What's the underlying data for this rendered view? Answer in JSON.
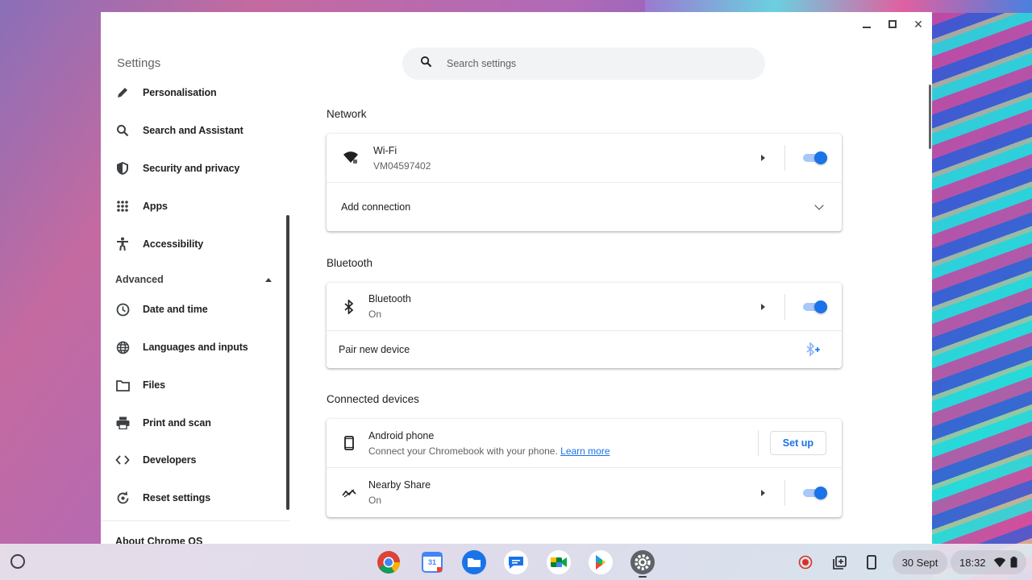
{
  "window": {
    "controls": {
      "minimize": "minimize",
      "maximize": "maximize",
      "close": "✕"
    }
  },
  "sidebar": {
    "title": "Settings",
    "items": [
      {
        "label": "Personalisation",
        "icon": "pencil-icon"
      },
      {
        "label": "Search and Assistant",
        "icon": "search-icon"
      },
      {
        "label": "Security and privacy",
        "icon": "shield-icon"
      },
      {
        "label": "Apps",
        "icon": "apps-grid-icon"
      },
      {
        "label": "Accessibility",
        "icon": "accessibility-icon"
      }
    ],
    "advanced": {
      "label": "Advanced",
      "items": [
        {
          "label": "Date and time",
          "icon": "clock-icon"
        },
        {
          "label": "Languages and inputs",
          "icon": "globe-icon"
        },
        {
          "label": "Files",
          "icon": "folder-icon"
        },
        {
          "label": "Print and scan",
          "icon": "printer-icon"
        },
        {
          "label": "Developers",
          "icon": "code-icon"
        },
        {
          "label": "Reset settings",
          "icon": "reset-icon"
        }
      ]
    },
    "about": "About Chrome OS"
  },
  "search": {
    "placeholder": "Search settings"
  },
  "network": {
    "title": "Network",
    "wifi": {
      "title": "Wi-Fi",
      "subtitle": "VM04597402",
      "enabled": true
    },
    "add_connection": "Add connection"
  },
  "bluetooth": {
    "title": "Bluetooth",
    "main": {
      "title": "Bluetooth",
      "subtitle": "On",
      "enabled": true
    },
    "pair": "Pair new device"
  },
  "connected": {
    "title": "Connected devices",
    "android": {
      "title": "Android phone",
      "subtitle": "Connect your Chromebook with your phone.",
      "link": "Learn more",
      "button": "Set up"
    },
    "nearby": {
      "title": "Nearby Share",
      "subtitle": "On",
      "enabled": true
    }
  },
  "shelf": {
    "date": "30 Sept",
    "time": "18:32",
    "apps": [
      "chrome-icon",
      "calendar-icon",
      "files-icon",
      "messages-icon",
      "meet-icon",
      "play-store-icon",
      "settings-icon"
    ],
    "calendar_day": "31"
  },
  "colors": {
    "accent": "#1a73e8",
    "toggle_track": "#a8c7fa"
  }
}
